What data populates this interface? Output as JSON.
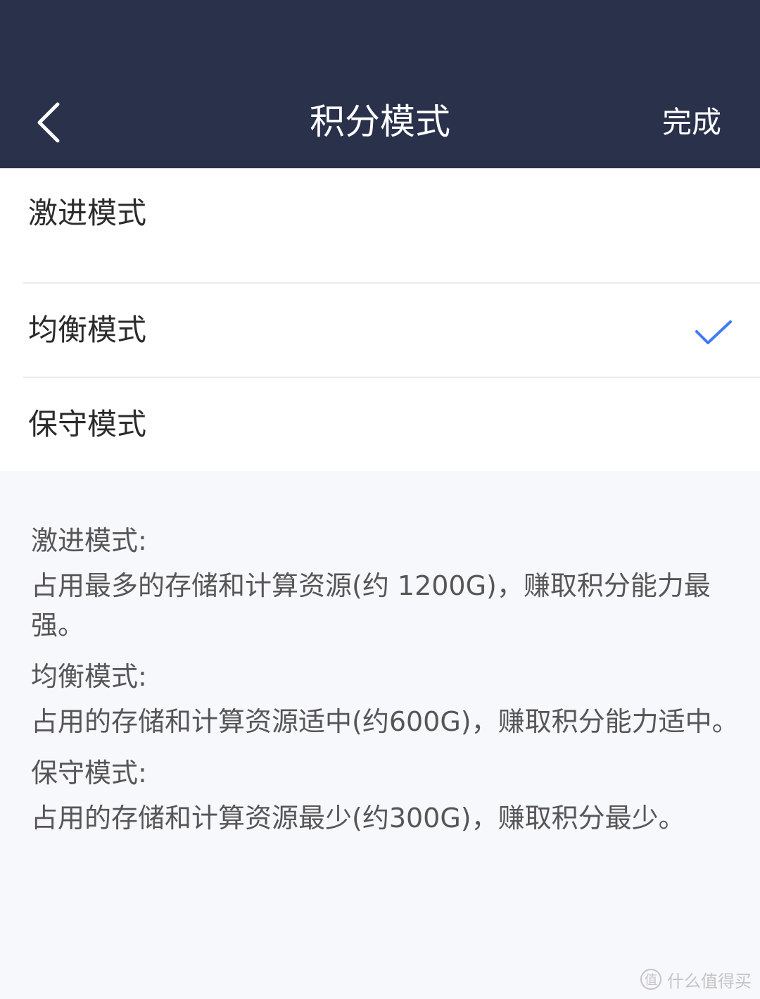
{
  "nav": {
    "title": "积分模式",
    "done_label": "完成"
  },
  "options": [
    {
      "label": "激进模式",
      "selected": false
    },
    {
      "label": "均衡模式",
      "selected": true
    },
    {
      "label": "保守模式",
      "selected": false
    }
  ],
  "descriptions": [
    {
      "title": "激进模式:",
      "body": "占用最多的存储和计算资源(约 1200G)，赚取积分能力最强。"
    },
    {
      "title": "均衡模式:",
      "body": "占用的存储和计算资源适中(约600G)，赚取积分能力适中。"
    },
    {
      "title": "保守模式:",
      "body": "占用的存储和计算资源最少(约300G)，赚取积分最少。"
    }
  ],
  "watermark": {
    "glyph": "值",
    "text": "什么值得买"
  },
  "colors": {
    "navbar": "#2a314b",
    "accent": "#3e7bf7",
    "page_bg": "#f7f8fc"
  },
  "icons": {
    "back": "chevron-left-icon",
    "selected": "checkmark-icon"
  }
}
